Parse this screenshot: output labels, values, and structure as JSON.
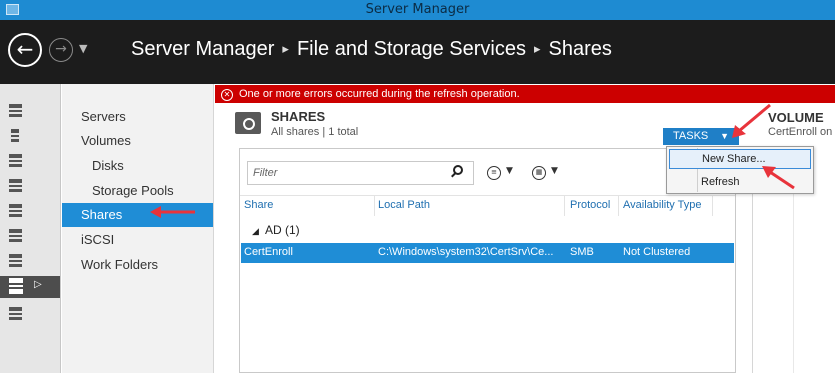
{
  "window": {
    "title": "Server Manager"
  },
  "header": {
    "breadcrumb": [
      "Server Manager",
      "File and Storage Services",
      "Shares"
    ],
    "separator": "▸"
  },
  "sidebar": {
    "items": [
      {
        "label": "Servers"
      },
      {
        "label": "Volumes"
      },
      {
        "label": "Disks"
      },
      {
        "label": "Storage Pools"
      },
      {
        "label": "Shares"
      },
      {
        "label": "iSCSI"
      },
      {
        "label": "Work Folders"
      }
    ]
  },
  "error": {
    "message": "One or more errors occurred during the refresh operation."
  },
  "shares": {
    "title": "SHARES",
    "subtitle": "All shares | 1 total",
    "tasks_label": "TASKS",
    "filter_placeholder": "Filter",
    "columns": [
      "Share",
      "Local Path",
      "Protocol",
      "Availability Type"
    ],
    "group": "AD (1)",
    "rows": [
      {
        "share": "CertEnroll",
        "path": "C:\\Windows\\system32\\CertSrv\\Ce...",
        "protocol": "SMB",
        "availability": "Not Clustered"
      }
    ]
  },
  "volume": {
    "title": "VOLUME",
    "subtitle": "CertEnroll on"
  },
  "tasks_menu": {
    "items": [
      "New Share...",
      "Refresh"
    ]
  },
  "colors": {
    "accent": "#1f8dd6",
    "error": "#cc0000",
    "header": "#1c1c1c",
    "titlebar": "#1e8bd2",
    "annotation": "#e8333b"
  }
}
